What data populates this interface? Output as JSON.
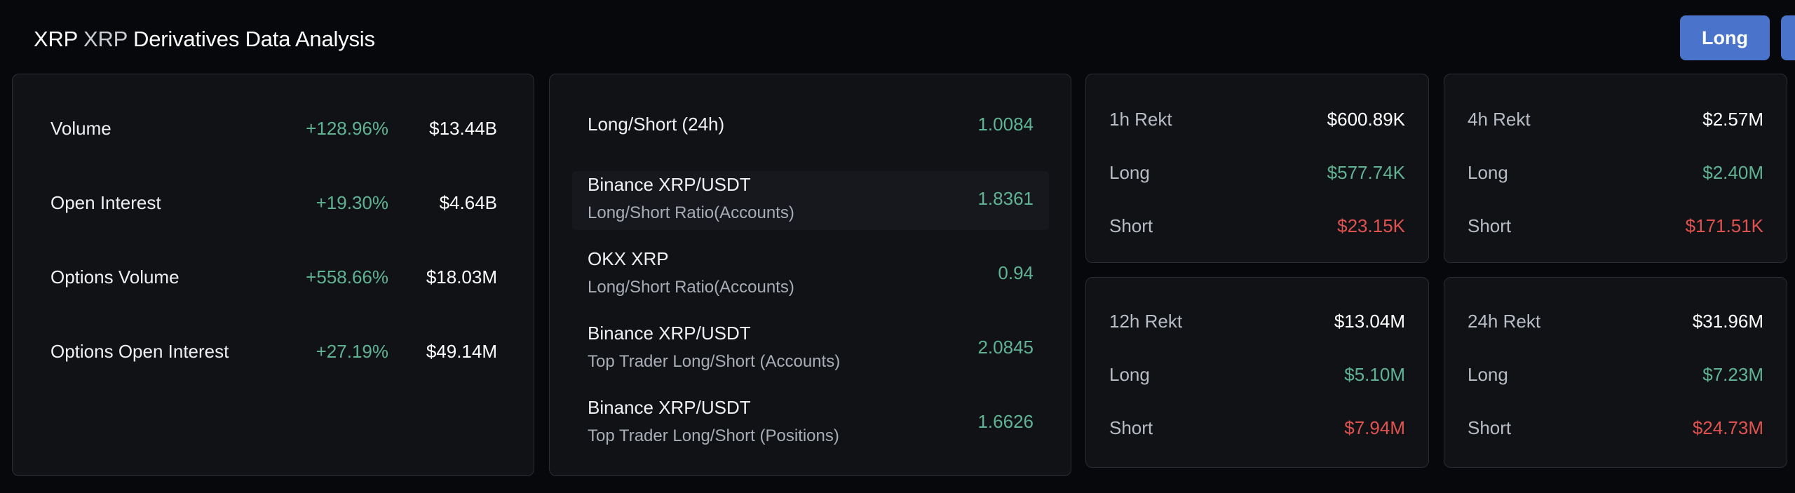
{
  "header": {
    "symbol": "XRP",
    "symbol_icon_text": "XRP",
    "title": "Derivatives Data Analysis",
    "long_button": "Long"
  },
  "overview": [
    {
      "label": "Volume",
      "change": "+128.96%",
      "value": "$13.44B"
    },
    {
      "label": "Open Interest",
      "change": "+19.30%",
      "value": "$4.64B"
    },
    {
      "label": "Options Volume",
      "change": "+558.66%",
      "value": "$18.03M"
    },
    {
      "label": "Options Open Interest",
      "change": "+27.19%",
      "value": "$49.14M"
    }
  ],
  "ratios": [
    {
      "title": "Long/Short (24h)",
      "sub": "",
      "value": "1.0084"
    },
    {
      "title": "Binance XRP/USDT",
      "sub": "Long/Short Ratio(Accounts)",
      "value": "1.8361"
    },
    {
      "title": "OKX XRP",
      "sub": "Long/Short Ratio(Accounts)",
      "value": "0.94"
    },
    {
      "title": "Binance XRP/USDT",
      "sub": "Top Trader Long/Short (Accounts)",
      "value": "2.0845"
    },
    {
      "title": "Binance XRP/USDT",
      "sub": "Top Trader Long/Short (Positions)",
      "value": "1.6626"
    }
  ],
  "rekt": {
    "long_label": "Long",
    "short_label": "Short",
    "panels": [
      {
        "label": "1h Rekt",
        "total": "$600.89K",
        "long": "$577.74K",
        "short": "$23.15K"
      },
      {
        "label": "4h Rekt",
        "total": "$2.57M",
        "long": "$2.40M",
        "short": "$171.51K"
      },
      {
        "label": "12h Rekt",
        "total": "$13.04M",
        "long": "$5.10M",
        "short": "$7.94M"
      },
      {
        "label": "24h Rekt",
        "total": "$31.96M",
        "long": "$7.23M",
        "short": "$24.73M"
      }
    ]
  },
  "colors": {
    "background": "#07080b",
    "panel": "#101216",
    "accent": "#4a74cc",
    "positive": "#5fb393",
    "negative": "#e0524f"
  }
}
